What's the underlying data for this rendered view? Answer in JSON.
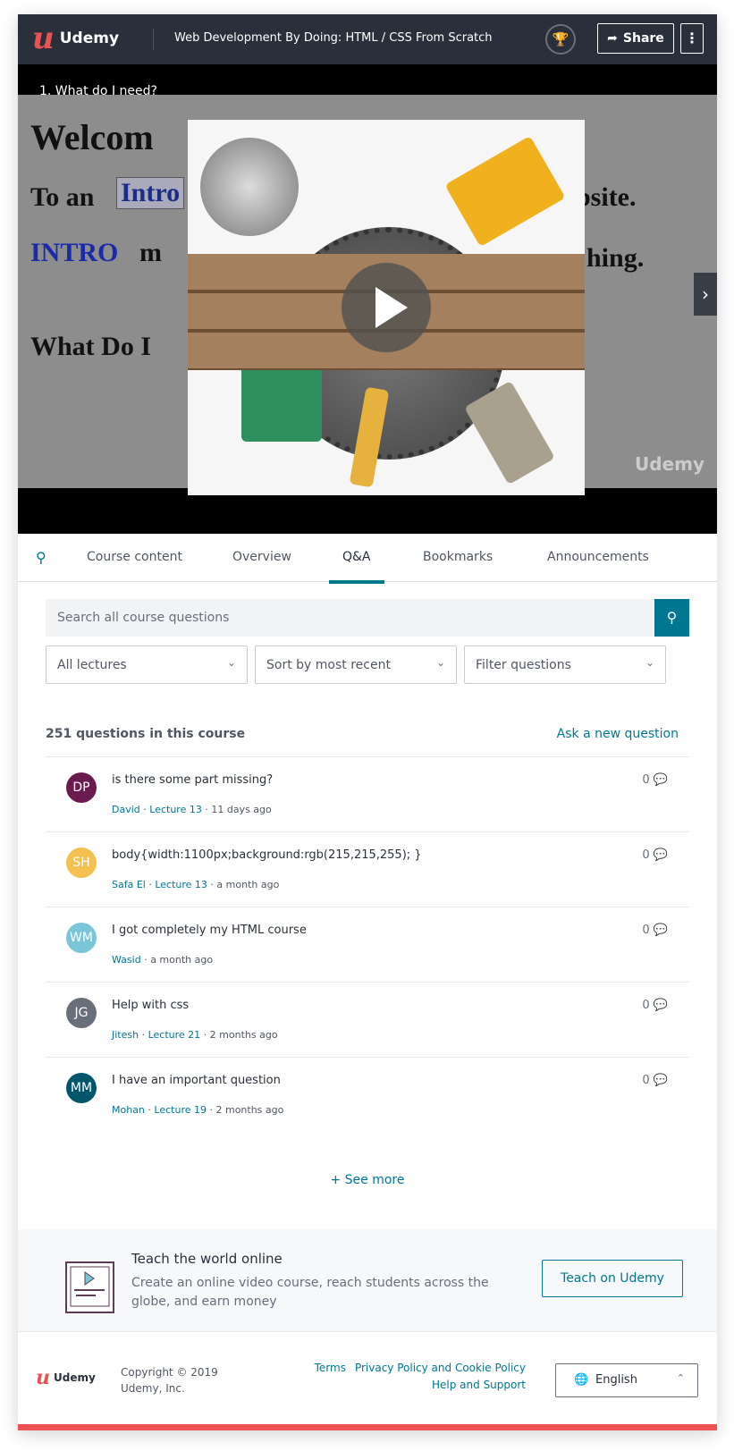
{
  "header": {
    "logo_text": "Udemy",
    "course_title": "Web Development By Doing: HTML / CSS From Scratch",
    "share_label": "Share",
    "trophy_icon": "trophy-icon",
    "more_icon": "vertical-dots-icon"
  },
  "video": {
    "lecture_title": "1. What do I need?",
    "slide_lines": [
      "Welcom",
      "To an",
      "Intro",
      "bsite.",
      "INTRO",
      "m",
      "hing.",
      "What Do I"
    ],
    "watermark": "Udemy"
  },
  "tabs": [
    {
      "label": "Course content"
    },
    {
      "label": "Overview"
    },
    {
      "label": "Q&A",
      "active": true
    },
    {
      "label": "Bookmarks"
    },
    {
      "label": "Announcements"
    }
  ],
  "qa": {
    "search_placeholder": "Search all course questions",
    "filters": [
      "All lectures",
      "Sort by most recent",
      "Filter questions"
    ],
    "count_label": "251 questions in this course",
    "ask_label": "Ask a new question",
    "see_more": "+ See more",
    "questions": [
      {
        "initials": "DP",
        "color": "#6b1a4f",
        "title": "is there some part missing?",
        "author": "David",
        "lecture": "Lecture 13",
        "time": "11 days ago",
        "replies": "0"
      },
      {
        "initials": "SH",
        "color": "#f4c150",
        "title": "body{width:1100px;background:rgb(215,215,255); }",
        "author": "Safa El",
        "lecture": "Lecture 13",
        "time": "a month ago",
        "replies": "0"
      },
      {
        "initials": "WM",
        "color": "#7ac6d8",
        "title": "I got completely my HTML course",
        "author": "Wasid",
        "lecture": "",
        "time": "a month ago",
        "replies": "0"
      },
      {
        "initials": "JG",
        "color": "#686f7a",
        "title": "Help with css",
        "author": "Jitesh",
        "lecture": "Lecture 21",
        "time": "2 months ago",
        "replies": "0"
      },
      {
        "initials": "MM",
        "color": "#00576b",
        "title": "I have an important question",
        "author": "Mohan",
        "lecture": "Lecture 19",
        "time": "2 months ago",
        "replies": "0"
      }
    ]
  },
  "teach": {
    "title": "Teach the world online",
    "description": "Create an online video course, reach students across the globe, and earn money",
    "button": "Teach on Udemy"
  },
  "footer": {
    "logo_text": "Udemy",
    "copyright_1": "Copyright © 2019",
    "copyright_2": "Udemy, Inc.",
    "links": [
      "Terms",
      "Privacy Policy and Cookie Policy",
      "Help and Support"
    ],
    "language": "English"
  },
  "colors": {
    "brand": "#ec5252",
    "accent": "#007791",
    "header_bg": "#29303b"
  }
}
